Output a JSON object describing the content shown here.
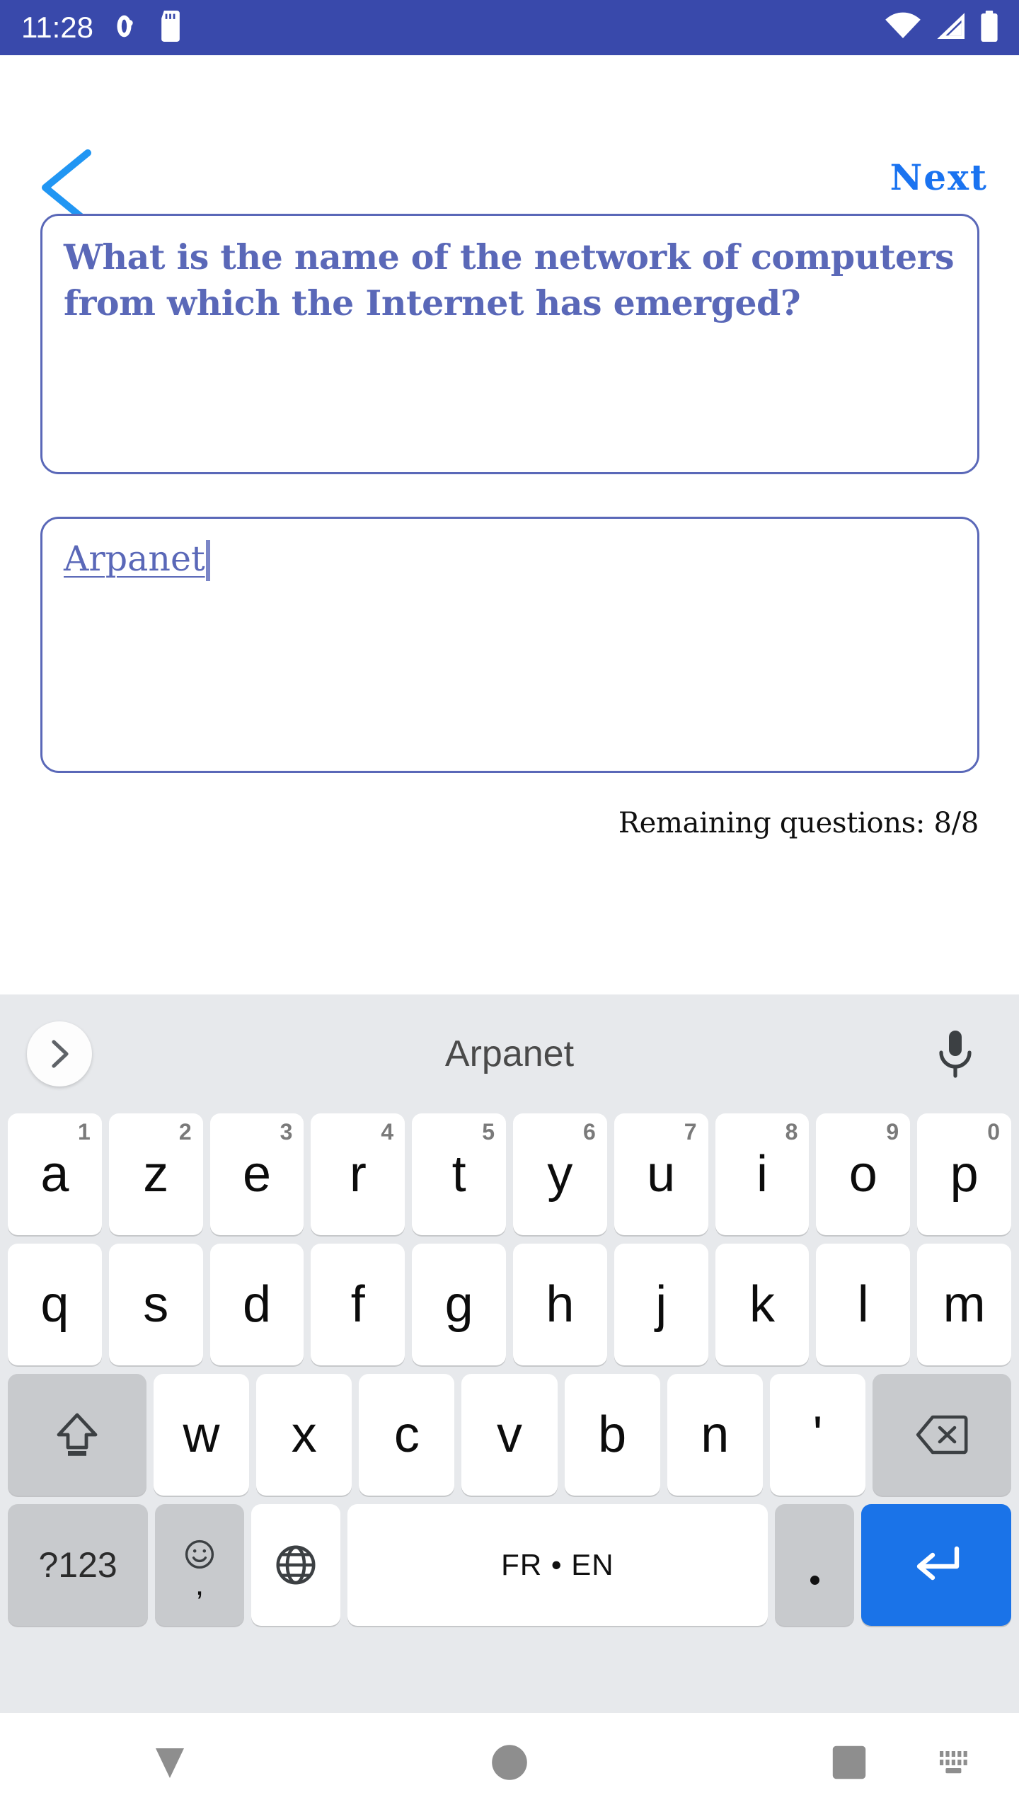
{
  "status_bar": {
    "clock": "11:28",
    "background_color": "#3949ab",
    "left_icons": [
      "screen-rotation-icon",
      "sd-card-icon"
    ],
    "right_icons": [
      "wifi-icon",
      "cell-signal-icon",
      "battery-full-icon"
    ]
  },
  "header": {
    "back_icon": "chevron-left-icon",
    "next_label": "Next",
    "next_color": "#1a73f0"
  },
  "question": {
    "text": "What is the name of the network of computers from which the Internet has emerged?",
    "text_color": "#5a68b8",
    "border_color": "#5a68b8"
  },
  "answer": {
    "value": "Arpanet",
    "placeholder": "",
    "text_color": "#5a68b8",
    "border_color": "#5a68b8"
  },
  "status": {
    "remaining_label": "Remaining questions: 8/8"
  },
  "keyboard": {
    "background_color": "#e7e9ec",
    "suggestion": {
      "expand_icon": "chevron-right-icon",
      "word": "Arpanet",
      "mic_icon": "microphone-icon"
    },
    "row1": [
      {
        "label": "a",
        "digit": "1"
      },
      {
        "label": "z",
        "digit": "2"
      },
      {
        "label": "e",
        "digit": "3"
      },
      {
        "label": "r",
        "digit": "4"
      },
      {
        "label": "t",
        "digit": "5"
      },
      {
        "label": "y",
        "digit": "6"
      },
      {
        "label": "u",
        "digit": "7"
      },
      {
        "label": "i",
        "digit": "8"
      },
      {
        "label": "o",
        "digit": "9"
      },
      {
        "label": "p",
        "digit": "0"
      }
    ],
    "row2": [
      {
        "label": "q"
      },
      {
        "label": "s"
      },
      {
        "label": "d"
      },
      {
        "label": "f"
      },
      {
        "label": "g"
      },
      {
        "label": "h"
      },
      {
        "label": "j"
      },
      {
        "label": "k"
      },
      {
        "label": "l"
      },
      {
        "label": "m"
      }
    ],
    "row3": {
      "shift_icon": "shift-arrow-icon",
      "letters": [
        {
          "label": "w"
        },
        {
          "label": "x"
        },
        {
          "label": "c"
        },
        {
          "label": "v"
        },
        {
          "label": "b"
        },
        {
          "label": "n"
        },
        {
          "label": "'"
        }
      ],
      "backspace_icon": "backspace-icon"
    },
    "row4": {
      "symbols_label": "?123",
      "emoji_icon": "smiley-face-icon",
      "comma_label": ",",
      "globe_icon": "globe-language-icon",
      "space_label": "FR • EN",
      "period_label": ".",
      "enter_icon": "enter-return-icon",
      "enter_color": "#1a73e8"
    }
  },
  "nav_bar": {
    "back_icon": "keyboard-dismiss-down-icon",
    "home_icon": "home-circle-icon",
    "recents_icon": "recents-square-icon",
    "switch_keyboard_icon": "keyboard-icon"
  }
}
